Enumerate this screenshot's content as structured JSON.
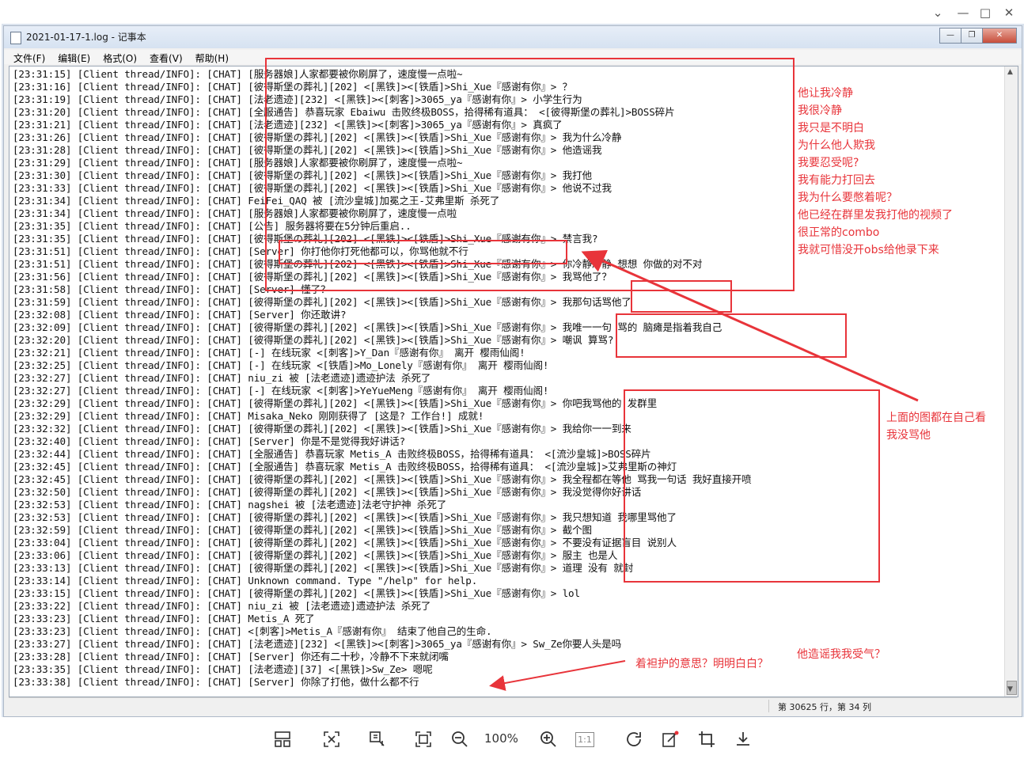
{
  "notepad": {
    "title": "2021-01-17-1.log - 记事本",
    "menus": [
      "文件(F)",
      "编辑(E)",
      "格式(O)",
      "查看(V)",
      "帮助(H)"
    ],
    "status_position": "第 30625 行，第 34 列"
  },
  "viewer": {
    "zoom": "100%",
    "one_to_one": "1:1"
  },
  "log_lines": [
    "[23:31:15] [Client thread/INFO]: [CHAT] [服务器娘]人家都要被你刷屏了，速度慢一点啦~",
    "[23:31:16] [Client thread/INFO]: [CHAT] [彼得斯堡の葬礼][202] <[黑铁]><[铁盾]>Shi_Xue『感谢有你』> ？",
    "[23:31:19] [Client thread/INFO]: [CHAT] [法老遗迹][232] <[黑铁]><[刺客]>3065_ya『感谢有你』> 小学生行为",
    "[23:31:20] [Client thread/INFO]: [CHAT] [全服通告] 恭喜玩家 Ebaiwu 击败终极BOSS，拾得稀有道具： <[彼得斯堡の葬礼]>BOSS碎片",
    "[23:31:21] [Client thread/INFO]: [CHAT] [法老遗迹][232] <[黑铁]><[刺客]>3065_ya『感谢有你』> 真疯了",
    "[23:31:26] [Client thread/INFO]: [CHAT] [彼得斯堡の葬礼][202] <[黑铁]><[铁盾]>Shi_Xue『感谢有你』> 我为什么冷静",
    "[23:31:28] [Client thread/INFO]: [CHAT] [彼得斯堡の葬礼][202] <[黑铁]><[铁盾]>Shi_Xue『感谢有你』> 他造谣我",
    "[23:31:29] [Client thread/INFO]: [CHAT] [服务器娘]人家都要被你刷屏了，速度慢一点啦~",
    "[23:31:30] [Client thread/INFO]: [CHAT] [彼得斯堡の葬礼][202] <[黑铁]><[铁盾]>Shi_Xue『感谢有你』> 我打他",
    "[23:31:33] [Client thread/INFO]: [CHAT] [彼得斯堡の葬礼][202] <[黑铁]><[铁盾]>Shi_Xue『感谢有你』> 他说不过我",
    "[23:31:34] [Client thread/INFO]: [CHAT] FeiFei_QAQ 被 [流沙皇城]加冕之王-艾弗里斯 杀死了",
    "[23:31:34] [Client thread/INFO]: [CHAT] [服务器娘]人家都要被你刷屏了，速度慢一点啦",
    "[23:31:35] [Client thread/INFO]: [CHAT] [公告] 服务器将要在5分钟后重启..",
    "[23:31:35] [Client thread/INFO]: [CHAT] [彼得斯堡の葬礼][202] <[黑铁]><[铁盾]>Shi_Xue『感谢有你』> 禁言我?",
    "[23:31:51] [Client thread/INFO]: [CHAT] [Server] 你打他你打死他都可以，你骂他就不行",
    "[23:31:51] [Client thread/INFO]: [CHAT] [彼得斯堡の葬礼][202] <[黑铁]><[铁盾]>Shi_Xue『感谢有你』> 你冷静冷静 想想 你做的对不对",
    "[23:31:56] [Client thread/INFO]: [CHAT] [彼得斯堡の葬礼][202] <[黑铁]><[铁盾]>Shi_Xue『感谢有你』> 我骂他了？",
    "[23:31:58] [Client thread/INFO]: [CHAT] [Server] 懂了？",
    "[23:31:59] [Client thread/INFO]: [CHAT] [彼得斯堡の葬礼][202] <[黑铁]><[铁盾]>Shi_Xue『感谢有你』> 我那句话骂他了",
    "[23:32:08] [Client thread/INFO]: [CHAT] [Server] 你还敢讲?",
    "[23:32:09] [Client thread/INFO]: [CHAT] [彼得斯堡の葬礼][202] <[黑铁]><[铁盾]>Shi_Xue『感谢有你』> 我唯一一句 骂的 脑瘫是指着我自己",
    "[23:32:20] [Client thread/INFO]: [CHAT] [彼得斯堡の葬礼][202] <[黑铁]><[铁盾]>Shi_Xue『感谢有你』> 嘲讽 算骂?",
    "[23:32:21] [Client thread/INFO]: [CHAT] [-] 在线玩家 <[刺客]>Y_Dan『感谢有你』 离开 樱雨仙阁!",
    "[23:32:25] [Client thread/INFO]: [CHAT] [-] 在线玩家 <[铁盾]>Mo_Lonely『感谢有你』 离开 樱雨仙阁!",
    "[23:32:27] [Client thread/INFO]: [CHAT] niu_zi 被 [法老遗迹]遗迹护法 杀死了",
    "[23:32:27] [Client thread/INFO]: [CHAT] [-] 在线玩家 <[刺客]>YeYueMeng『感谢有你』 离开 樱雨仙阁!",
    "[23:32:29] [Client thread/INFO]: [CHAT] [彼得斯堡の葬礼][202] <[黑铁]><[铁盾]>Shi_Xue『感谢有你』> 你吧我骂他的 发群里",
    "[23:32:29] [Client thread/INFO]: [CHAT] Misaka_Neko 刚刚获得了 [这是? 工作台!] 成就!",
    "[23:32:32] [Client thread/INFO]: [CHAT] [彼得斯堡の葬礼][202] <[黑铁]><[铁盾]>Shi_Xue『感谢有你』> 我给你一一到来",
    "[23:32:40] [Client thread/INFO]: [CHAT] [Server] 你是不是觉得我好讲话?",
    "[23:32:44] [Client thread/INFO]: [CHAT] [全服通告] 恭喜玩家 Metis_A 击败终极BOSS，拾得稀有道具： <[流沙皇城]>BOSS碎片",
    "[23:32:45] [Client thread/INFO]: [CHAT] [全服通告] 恭喜玩家 Metis_A 击败终极BOSS，拾得稀有道具： <[流沙皇城]>艾弗里斯の神灯",
    "[23:32:45] [Client thread/INFO]: [CHAT] [彼得斯堡の葬礼][202] <[黑铁]><[铁盾]>Shi_Xue『感谢有你』> 我全程都在等他 骂我一句话 我好直接开喷",
    "[23:32:50] [Client thread/INFO]: [CHAT] [彼得斯堡の葬礼][202] <[黑铁]><[铁盾]>Shi_Xue『感谢有你』> 我没觉得你好讲话",
    "[23:32:53] [Client thread/INFO]: [CHAT] nagshei 被 [法老遗迹]法老守护神 杀死了",
    "[23:32:53] [Client thread/INFO]: [CHAT] [彼得斯堡の葬礼][202] <[黑铁]><[铁盾]>Shi_Xue『感谢有你』> 我只想知道 我哪里骂他了",
    "[23:32:59] [Client thread/INFO]: [CHAT] [彼得斯堡の葬礼][202] <[黑铁]><[铁盾]>Shi_Xue『感谢有你』> 截个图",
    "[23:33:04] [Client thread/INFO]: [CHAT] [彼得斯堡の葬礼][202] <[黑铁]><[铁盾]>Shi_Xue『感谢有你』> 不要没有证据盲目 说别人",
    "[23:33:06] [Client thread/INFO]: [CHAT] [彼得斯堡の葬礼][202] <[黑铁]><[铁盾]>Shi_Xue『感谢有你』> 服主 也是人",
    "[23:33:13] [Client thread/INFO]: [CHAT] [彼得斯堡の葬礼][202] <[黑铁]><[铁盾]>Shi_Xue『感谢有你』> 道理 没有 就封",
    "[23:33:14] [Client thread/INFO]: [CHAT] Unknown command. Type \"/help\" for help.",
    "[23:33:15] [Client thread/INFO]: [CHAT] [彼得斯堡の葬礼][202] <[黑铁]><[铁盾]>Shi_Xue『感谢有你』> lol",
    "[23:33:22] [Client thread/INFO]: [CHAT] niu_zi 被 [法老遗迹]遗迹护法 杀死了",
    "[23:33:23] [Client thread/INFO]: [CHAT] Metis_A 死了",
    "[23:33:23] [Client thread/INFO]: [CHAT] <[刺客]>Metis_A『感谢有你』 结束了他自己的生命.",
    "[23:33:27] [Client thread/INFO]: [CHAT] [法老遗迹][232] <[黑铁]><[刺客]>3065_ya『感谢有你』> Sw_Ze你要人头是吗",
    "[23:33:28] [Client thread/INFO]: [CHAT] [Server] 你还有二十秒，冷静不下来就闭嘴",
    "[23:33:35] [Client thread/INFO]: [CHAT] [法老遗迹][37] <[黑铁]>Sw_Ze> 嗯呢",
    "[23:33:38] [Client thread/INFO]: [CHAT] [Server] 你除了打他，做什么都不行"
  ],
  "annotations": {
    "right_lines": [
      "他让我冷静",
      "我很冷静",
      "我只是不明白",
      "为什么他人欺我",
      "我要忍受呢?",
      "我有能力打回去",
      "我为什么要憋着呢？",
      "他已经在群里发我打他的视频了",
      "很正常的combo",
      "我就可惜没开obs给他录下来"
    ],
    "mid_note_1": "上面的图都在自己看",
    "mid_note_2": "我没骂他",
    "bottom_note_1": "着袒护的意思？明明白白？",
    "bottom_note_2": "他造谣我我受气？",
    "color": "#e8343a"
  }
}
